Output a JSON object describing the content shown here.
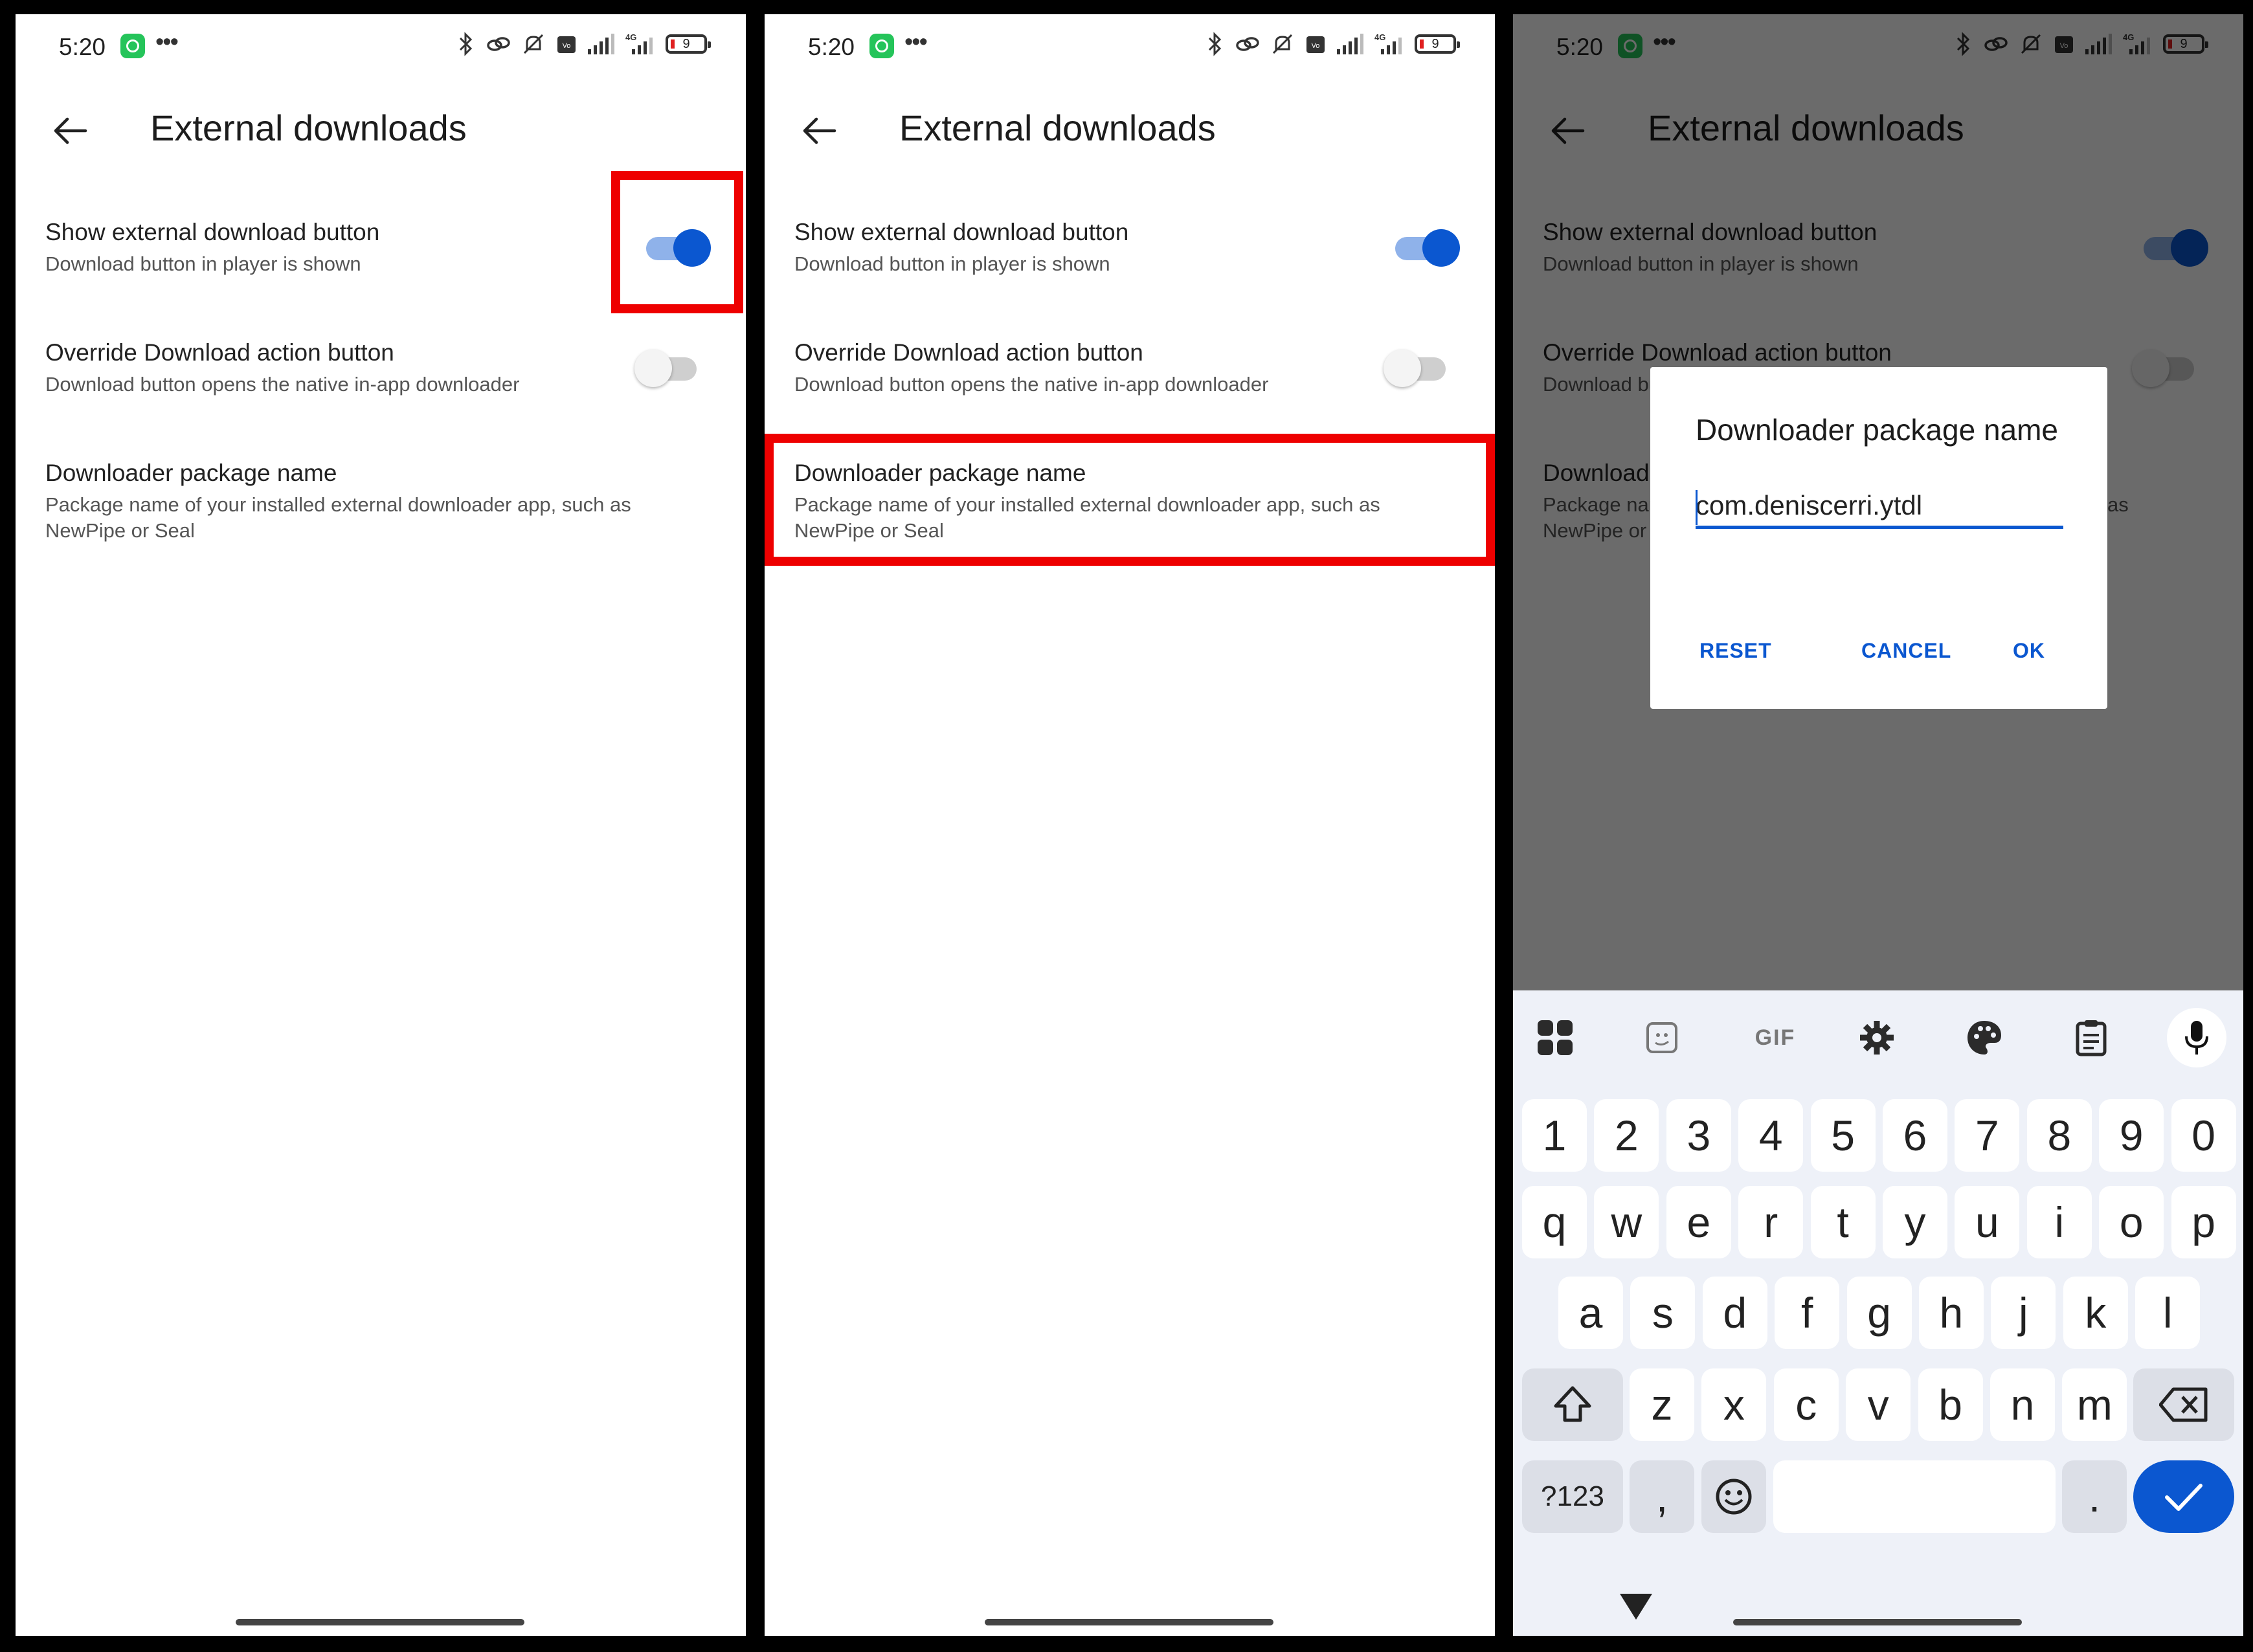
{
  "status_bar": {
    "time": "5:20",
    "battery": "9"
  },
  "page": {
    "title": "External downloads"
  },
  "settings": {
    "show_external": {
      "title": "Show external download button",
      "subtitle": "Download button in player is shown",
      "enabled": true
    },
    "override": {
      "title": "Override Download action button",
      "subtitle": "Download button opens the native in-app downloader",
      "enabled": false
    },
    "package": {
      "title": "Downloader package name",
      "subtitle": "Package name of your installed external downloader app, such as NewPipe or Seal"
    }
  },
  "dialog": {
    "title": "Downloader package name",
    "value": "com.deniscerri.ytdl",
    "reset": "RESET",
    "cancel": "CANCEL",
    "ok": "OK"
  },
  "keyboard": {
    "toolbar": [
      "apps-icon",
      "sticker-icon",
      "gif",
      "settings-icon",
      "palette-icon",
      "clipboard-icon",
      "mic-icon"
    ],
    "gif_label": "GIF",
    "row_numbers": [
      "1",
      "2",
      "3",
      "4",
      "5",
      "6",
      "7",
      "8",
      "9",
      "0"
    ],
    "row1": [
      "q",
      "w",
      "e",
      "r",
      "t",
      "y",
      "u",
      "i",
      "o",
      "p"
    ],
    "row2": [
      "a",
      "s",
      "d",
      "f",
      "g",
      "h",
      "j",
      "k",
      "l"
    ],
    "row3": [
      "z",
      "x",
      "c",
      "v",
      "b",
      "n",
      "m"
    ],
    "symbols_key": "?123",
    "comma_key": ",",
    "period_key": "."
  },
  "colors": {
    "accent": "#0b57d0",
    "highlight": "#ee0000",
    "whatsapp": "#25c45a"
  }
}
